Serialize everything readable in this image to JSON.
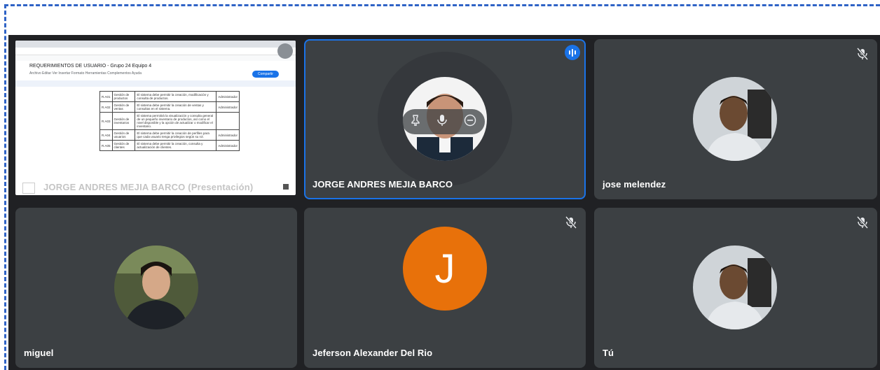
{
  "presentation": {
    "presenter_label": "JORGE ANDRES MEJIA BARCO (Presentación)",
    "doc_title": "REQUERIMIENTOS DE USUARIO - Grupo 24 Equipo 4",
    "doc_menu": "Archivo  Editar  Ver  Insertar  Formato  Herramientas  Complementos  Ayuda",
    "share_label": "Compartir",
    "rows": [
      {
        "id": "R.A01",
        "name": "Gestión de productos",
        "desc": "El sistema debe permitir la creación, modificación y consulta de productos.",
        "role": "Administrador"
      },
      {
        "id": "R.A02",
        "name": "Gestión de ventas",
        "desc": "El sistema debe permitir la creación de ventas y consultas en el sistema.",
        "role": "Administrador"
      },
      {
        "id": "R.A03",
        "name": "Gestión de inventarios",
        "desc": "El sistema permitirá la visualización y consulta general de un pequeño inventario de productos, así como el nivel disponible y la opción de actualizar o modificar el inventario.",
        "role": ""
      },
      {
        "id": "R.A04",
        "name": "Gestión de usuarios",
        "desc": "El sistema debe permitir la creación de perfiles para que cada usuario tenga privilegios según su rol.",
        "role": "Administrador"
      },
      {
        "id": "R.A05",
        "name": "Gestión de clientes",
        "desc": "El sistema debe permitir la creación, consulta y actualización de clientes.",
        "role": "Administrador"
      }
    ]
  },
  "participants": [
    {
      "name": "JORGE ANDRES MEJIA BARCO",
      "speaking": true,
      "muted": false,
      "avatar": "photo"
    },
    {
      "name": "jose melendez",
      "speaking": false,
      "muted": true,
      "avatar": "photo"
    },
    {
      "name": "miguel",
      "speaking": false,
      "muted": false,
      "avatar": "photo"
    },
    {
      "name": "Jeferson Alexander Del Rio",
      "speaking": false,
      "muted": true,
      "avatar": "letter",
      "letter": "J"
    },
    {
      "name": "Tú",
      "speaking": false,
      "muted": true,
      "avatar": "photo"
    }
  ],
  "hover_controls": [
    "pin-icon",
    "mic-icon",
    "remove-icon"
  ],
  "colors": {
    "stage": "#202124",
    "tile": "#3c4043",
    "accent": "#1a73e8",
    "letter_avatar": "#e8710a",
    "frame_dash": "#2f63c6"
  }
}
